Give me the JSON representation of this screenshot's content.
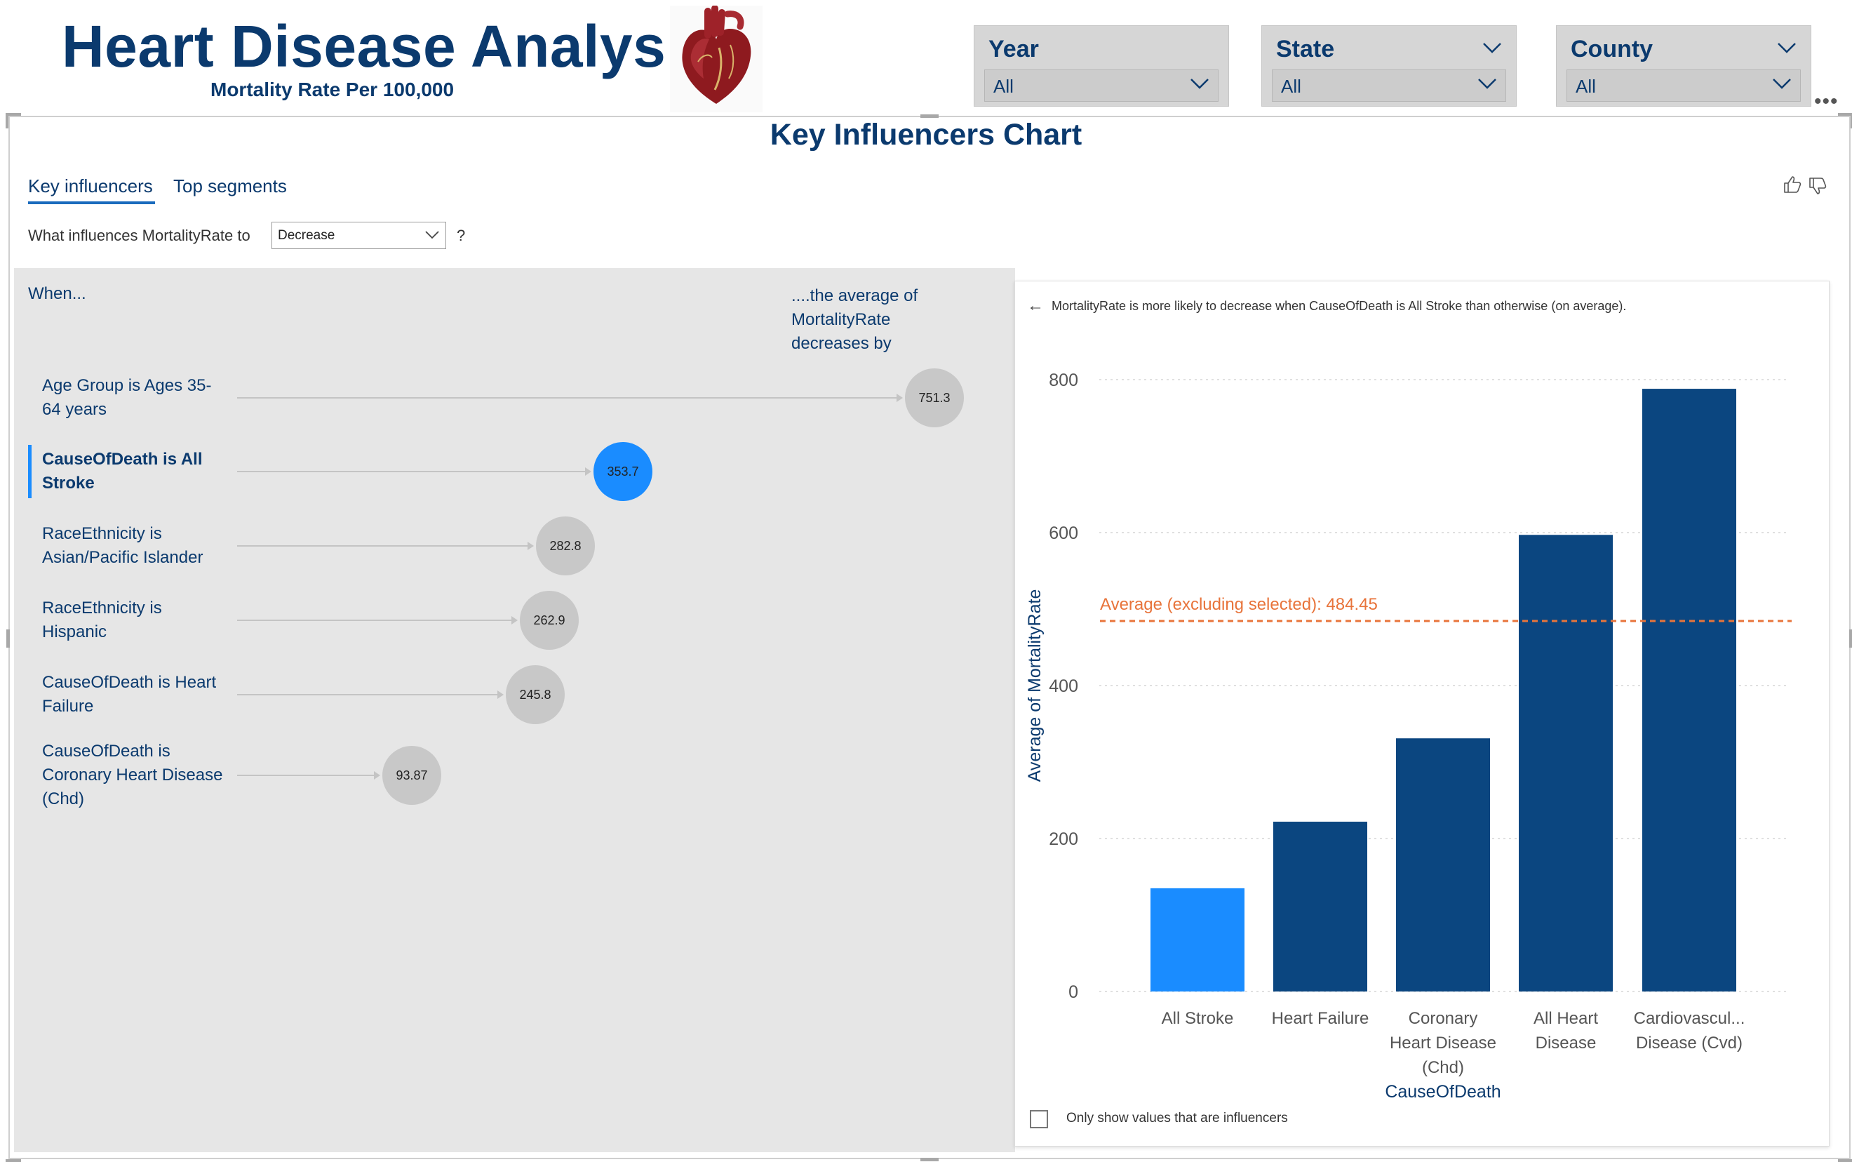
{
  "header": {
    "title": "Heart Disease Analysis",
    "subtitle": "Mortality Rate Per 100,000"
  },
  "slicers": [
    {
      "label": "Year",
      "value": "All"
    },
    {
      "label": "State",
      "value": "All"
    },
    {
      "label": "County",
      "value": "All"
    }
  ],
  "visual": {
    "title": "Key Influencers Chart",
    "tabs": [
      "Key influencers",
      "Top segments"
    ],
    "active_tab": "Key influencers",
    "question_prefix": "What influences MortalityRate to",
    "question_value": "Decrease",
    "question_suffix": "?",
    "column_when": "When...",
    "column_avg": "....the average of MortalityRate decreases by",
    "influencers": [
      {
        "label": "Age Group is Ages 35-64 years",
        "value": "751.3",
        "selected": false
      },
      {
        "label": "CauseOfDeath is All Stroke",
        "value": "353.7",
        "selected": true
      },
      {
        "label": "RaceEthnicity is Asian/Pacific Islander",
        "value": "282.8",
        "selected": false
      },
      {
        "label": "RaceEthnicity is Hispanic",
        "value": "262.9",
        "selected": false
      },
      {
        "label": "CauseOfDeath is Heart Failure",
        "value": "245.8",
        "selected": false
      },
      {
        "label": "CauseOfDeath is Coronary Heart Disease (Chd)",
        "value": "93.87",
        "selected": false
      }
    ],
    "detail": {
      "text": "MortalityRate is more likely to decrease when CauseOfDeath is All Stroke than otherwise (on average).",
      "checkbox_label": "Only show values that are influencers"
    }
  },
  "colors": {
    "brand": "#0b3a6e",
    "selected": "#1a8cff",
    "bar": "#0b4680",
    "average_line": "#e8743b",
    "bubble": "#c8c8c8"
  },
  "icons": [
    "heart-image",
    "chevron-down-icon",
    "more-options-icon",
    "thumbs-up-icon",
    "thumbs-down-icon",
    "back-arrow-icon"
  ],
  "chart_data": {
    "type": "bar",
    "categories": [
      "All Stroke",
      "Heart Failure",
      "Coronary Heart Disease (Chd)",
      "All Heart Disease",
      "Cardiovascul... Disease (Cvd)"
    ],
    "category_labels": [
      [
        "All Stroke"
      ],
      [
        "Heart Failure"
      ],
      [
        "Coronary",
        "Heart Disease",
        "(Chd)"
      ],
      [
        "All Heart",
        "Disease"
      ],
      [
        "Cardiovascul...",
        "Disease (Cvd)"
      ]
    ],
    "values": [
      135,
      222,
      331,
      597,
      788
    ],
    "highlighted_category": "All Stroke",
    "xlabel": "CauseOfDeath",
    "ylabel": "Average of MortalityRate",
    "ylim": [
      0,
      800
    ],
    "yticks": [
      0,
      200,
      400,
      600,
      800
    ],
    "reference_line": {
      "label": "Average (excluding selected): 484.45",
      "value": 484.45
    },
    "grid": true
  }
}
